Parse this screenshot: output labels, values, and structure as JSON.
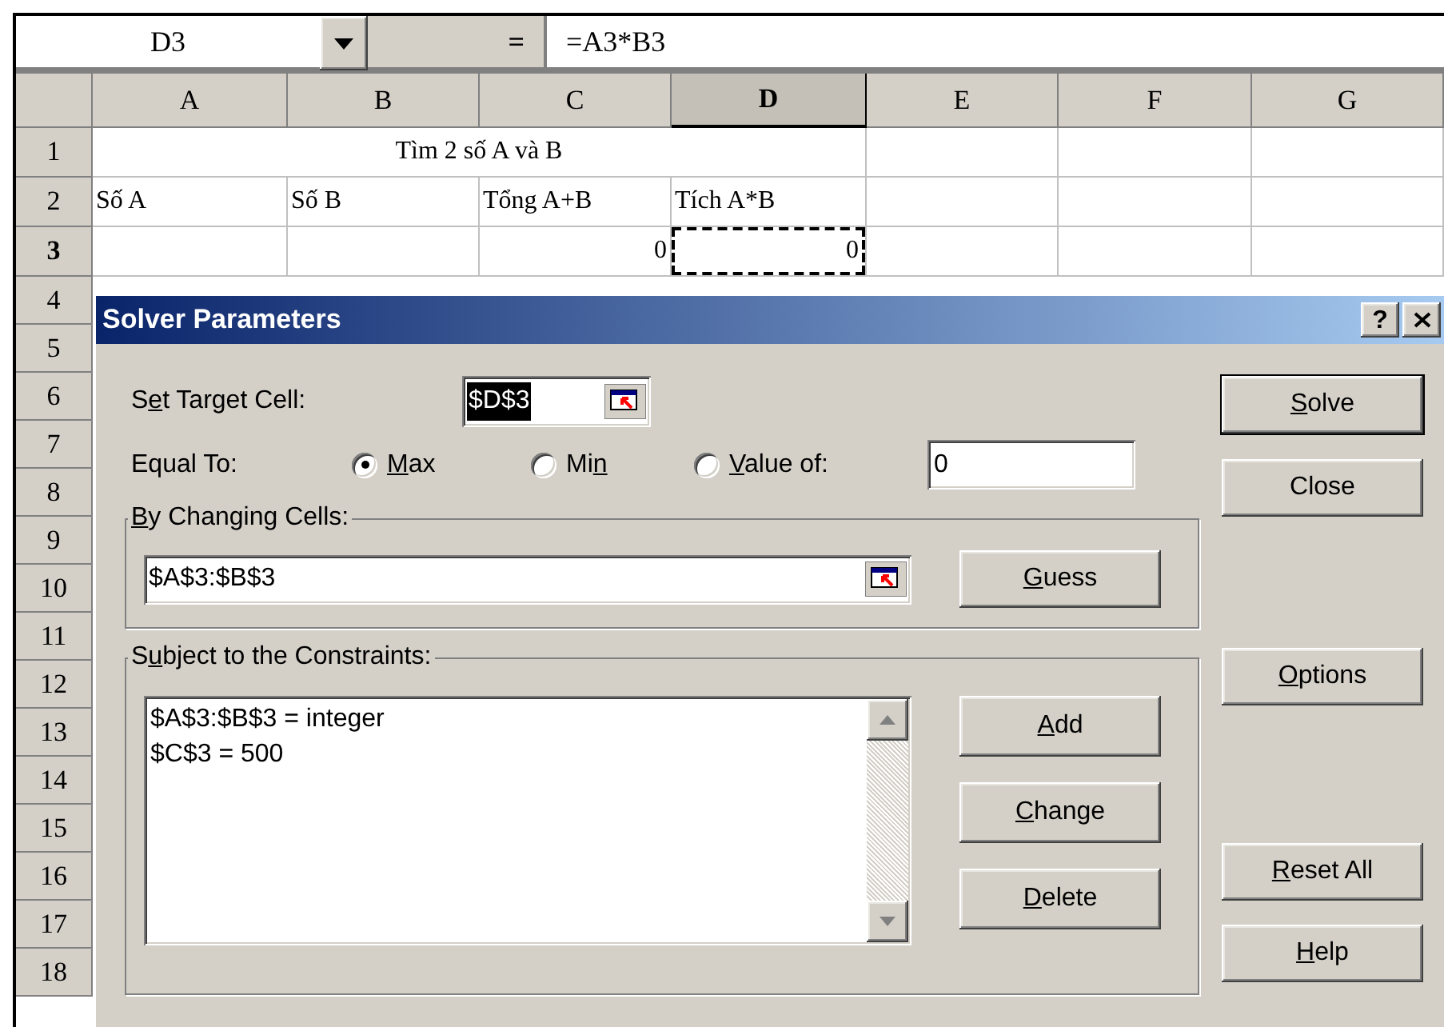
{
  "formula_bar": {
    "name_box": "D3",
    "equals": "=",
    "formula": "=A3*B3"
  },
  "sheet": {
    "columns": [
      {
        "label": "A",
        "selected": false
      },
      {
        "label": "B",
        "selected": false
      },
      {
        "label": "C",
        "selected": false
      },
      {
        "label": "D",
        "selected": true
      },
      {
        "label": "E",
        "selected": false
      },
      {
        "label": "F",
        "selected": false
      },
      {
        "label": "G",
        "selected": false
      }
    ],
    "rows": [
      {
        "label": "1",
        "selected": false,
        "kind": "title",
        "title": "Tìm 2 số A và B"
      },
      {
        "label": "2",
        "selected": false,
        "kind": "cells",
        "cells": [
          {
            "text": "Số A",
            "kind": "text",
            "selected": false
          },
          {
            "text": "Số B",
            "kind": "text",
            "selected": false
          },
          {
            "text": "Tổng A+B",
            "kind": "text",
            "selected": false
          },
          {
            "text": "Tích A*B",
            "kind": "text",
            "selected": false
          }
        ]
      },
      {
        "label": "3",
        "selected": true,
        "kind": "cells",
        "cells": [
          null,
          null,
          {
            "text": "0",
            "kind": "number",
            "selected": false
          },
          {
            "text": "0",
            "kind": "number",
            "selected": true
          }
        ]
      },
      {
        "label": "4",
        "selected": false,
        "kind": "hidden"
      },
      {
        "label": "5",
        "selected": false,
        "kind": "hidden"
      },
      {
        "label": "6",
        "selected": false,
        "kind": "hidden"
      },
      {
        "label": "7",
        "selected": false,
        "kind": "hidden"
      },
      {
        "label": "8",
        "selected": false,
        "kind": "hidden"
      },
      {
        "label": "9",
        "selected": false,
        "kind": "hidden"
      },
      {
        "label": "10",
        "selected": false,
        "kind": "hidden"
      },
      {
        "label": "11",
        "selected": false,
        "kind": "hidden"
      },
      {
        "label": "12",
        "selected": false,
        "kind": "hidden"
      },
      {
        "label": "13",
        "selected": false,
        "kind": "hidden"
      },
      {
        "label": "14",
        "selected": false,
        "kind": "hidden"
      },
      {
        "label": "15",
        "selected": false,
        "kind": "hidden"
      },
      {
        "label": "16",
        "selected": false,
        "kind": "hidden"
      },
      {
        "label": "17",
        "selected": false,
        "kind": "hidden"
      },
      {
        "label": "18",
        "selected": false,
        "kind": "hidden"
      }
    ]
  },
  "dialog": {
    "title": "Solver Parameters",
    "help_button": "?",
    "target": {
      "label": [
        {
          "text": "S"
        },
        {
          "text": "e",
          "underline": true
        },
        {
          "text": "t Target Cell:"
        }
      ],
      "value": "$D$3",
      "selected": true
    },
    "equal_to": {
      "label": "Equal To:",
      "value": "0",
      "options": [
        {
          "label": [
            {
              "text": "M",
              "underline": true
            },
            {
              "text": "ax"
            }
          ],
          "selected": true
        },
        {
          "label": [
            {
              "text": "Mi"
            },
            {
              "text": "n",
              "underline": true
            }
          ],
          "selected": false
        },
        {
          "label": [
            {
              "text": "V",
              "underline": true
            },
            {
              "text": "alue of:"
            }
          ],
          "selected": false
        }
      ]
    },
    "changing": {
      "label": [
        {
          "text": "B",
          "underline": true
        },
        {
          "text": "y Changing Cells:"
        }
      ],
      "value": "$A$3:$B$3",
      "button": [
        {
          "text": "G",
          "underline": true
        },
        {
          "text": "uess"
        }
      ]
    },
    "constraints": {
      "label": [
        {
          "text": "S"
        },
        {
          "text": "u",
          "underline": true
        },
        {
          "text": "bject to the Constraints:"
        }
      ],
      "items": [
        "$A$3:$B$3 = integer",
        "$C$3 = 500"
      ],
      "buttons": [
        [
          {
            "text": "A",
            "underline": true
          },
          {
            "text": "dd"
          }
        ],
        [
          {
            "text": "C",
            "underline": true
          },
          {
            "text": "hange"
          }
        ],
        [
          {
            "text": "D",
            "underline": true
          },
          {
            "text": "elete"
          }
        ]
      ]
    },
    "side_buttons": [
      {
        "label": [
          {
            "text": "S",
            "underline": true
          },
          {
            "text": "olve"
          }
        ],
        "default": true
      },
      {
        "label": [
          {
            "text": "Close"
          }
        ],
        "default": false
      },
      {
        "label": [
          {
            "text": "O",
            "underline": true
          },
          {
            "text": "ptions"
          }
        ],
        "default": false
      },
      {
        "label": [
          {
            "text": "R",
            "underline": true
          },
          {
            "text": "eset All"
          }
        ],
        "default": false
      },
      {
        "label": [
          {
            "text": "H",
            "underline": true
          },
          {
            "text": "elp"
          }
        ],
        "default": false
      }
    ]
  }
}
